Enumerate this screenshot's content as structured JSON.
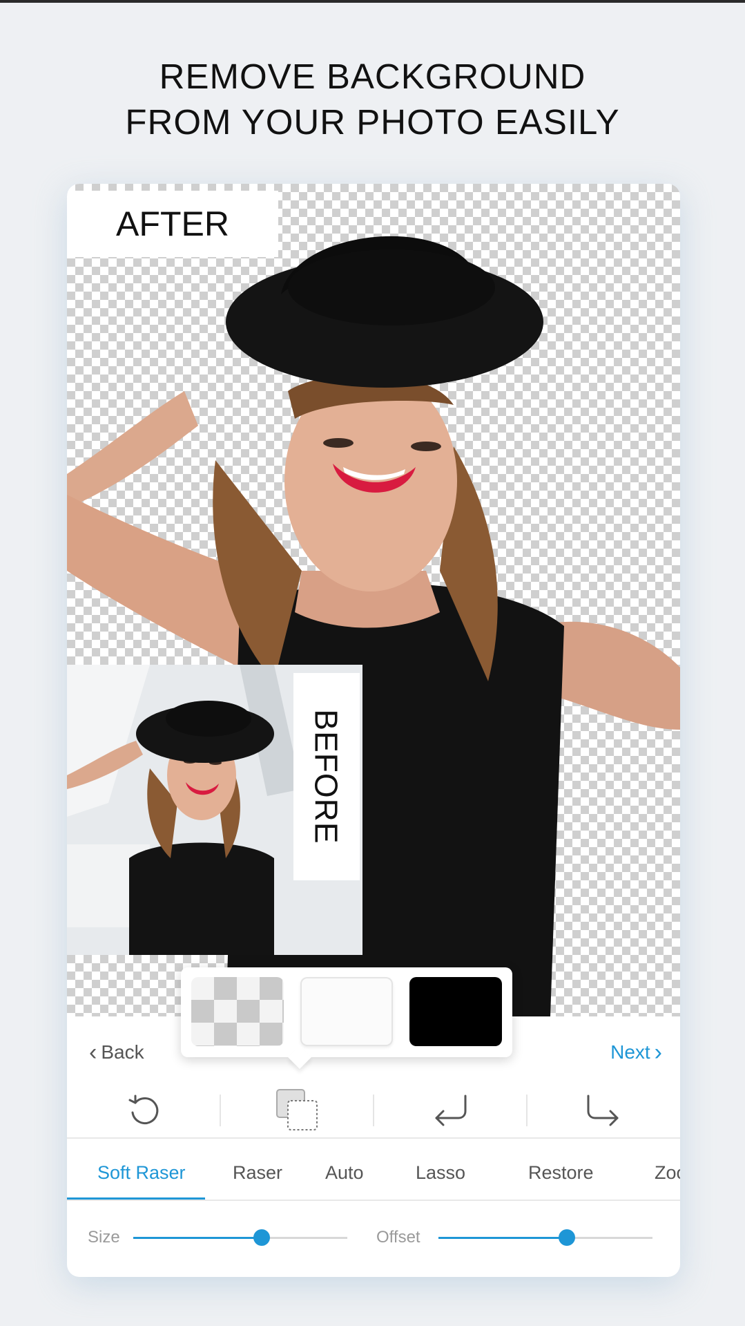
{
  "headline": {
    "line1": "REMOVE BACKGROUND",
    "line2": "FROM YOUR PHOTO EASILY"
  },
  "preview": {
    "after_label": "AFTER",
    "before_label": "BEFORE"
  },
  "background_options": [
    "transparent",
    "white",
    "black"
  ],
  "nav": {
    "back_label": "Back",
    "next_label": "Next"
  },
  "toolbar": {
    "icons": [
      "rotate-reset-icon",
      "background-layers-icon",
      "undo-icon",
      "redo-icon"
    ]
  },
  "tabs": [
    "Soft Raser",
    "Raser",
    "Auto",
    "Lasso",
    "Restore",
    "Zoo"
  ],
  "active_tab": "Soft Raser",
  "sliders": {
    "size": {
      "label": "Size",
      "value": 0.6
    },
    "offset": {
      "label": "Offset",
      "value": 0.6
    }
  },
  "colors": {
    "accent": "#1e96d6",
    "checker": "#cfcfcf",
    "lip": "#d81b40"
  }
}
